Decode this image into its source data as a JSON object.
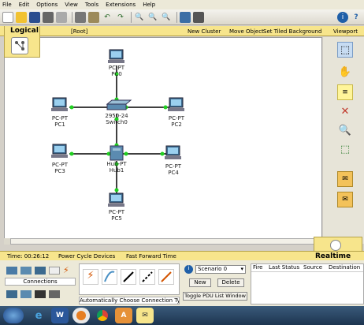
{
  "menu": [
    "File",
    "Edit",
    "Options",
    "View",
    "Tools",
    "Extensions",
    "Help"
  ],
  "logicalbar": {
    "tab": "Logical",
    "root": "[Root]",
    "new_cluster": "New Cluster",
    "move_object": "Move Object",
    "set_tiled_background": "Set Tiled Background",
    "viewport": "Viewport"
  },
  "nodes": [
    {
      "id": "PC0",
      "type": "PC-PT",
      "name": "PC0"
    },
    {
      "id": "Switch0",
      "type": "2950-24",
      "name": "Switch0"
    },
    {
      "id": "PC1",
      "type": "PC-PT",
      "name": "PC1"
    },
    {
      "id": "PC2",
      "type": "PC-PT",
      "name": "PC2"
    },
    {
      "id": "PC3",
      "type": "PC-PT",
      "name": "PC3"
    },
    {
      "id": "Hub1",
      "type": "Hub-PT",
      "name": "Hub1"
    },
    {
      "id": "PC4",
      "type": "PC-PT",
      "name": "PC4"
    },
    {
      "id": "PC5",
      "type": "PC-PT",
      "name": "PC5"
    }
  ],
  "timebar": {
    "time": "Time: 00:26:12",
    "power_cycle": "Power Cycle Devices",
    "fast_forward": "Fast Forward Time",
    "mode": "Realtime"
  },
  "bottom": {
    "connections_label": "Connections",
    "auto_connection": "Automatically Choose Connection Type",
    "scenario": "Scenario 0",
    "new_btn": "New",
    "delete_btn": "Delete",
    "toggle_pdu": "Toggle PDU List Window",
    "pdu_columns": [
      "Fire",
      "Last Status",
      "Source",
      "Destination"
    ]
  },
  "taskbar_apps": [
    "start-orb",
    "internet-explorer",
    "word",
    "media-player",
    "chrome",
    "pdf",
    "packet-tracer"
  ]
}
